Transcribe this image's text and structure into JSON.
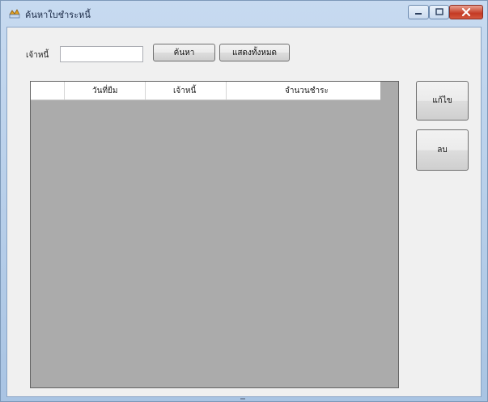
{
  "window": {
    "title": "ค้นหาใบชำระหนี้",
    "icon": "app-icon"
  },
  "search": {
    "label": "เจ้าหนี้",
    "value": "",
    "search_button": "ค้นหา",
    "show_all_button": "แสดงทั้งหมด"
  },
  "grid": {
    "columns": [
      "วันที่ยืม",
      "เจ้าหนี้",
      "จำนวนชำระ"
    ],
    "rows": []
  },
  "actions": {
    "edit_button": "แก้ไข",
    "delete_button": "ลบ"
  },
  "colors": {
    "grid_background": "#ababab",
    "form_background": "#f0f0f0",
    "close_button": "#c43a23"
  }
}
